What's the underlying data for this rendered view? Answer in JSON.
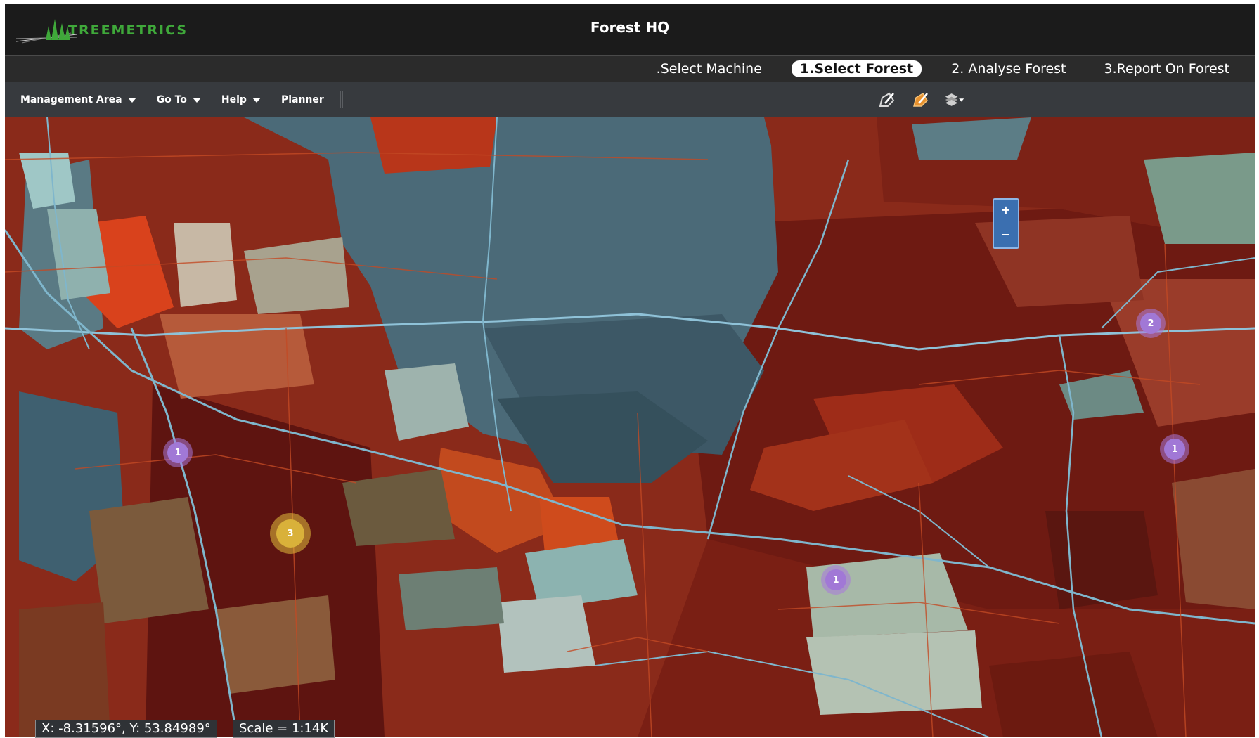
{
  "header": {
    "logo_text": "TREEMETRICS",
    "title": "Forest HQ"
  },
  "steps": [
    {
      "label": ".Select Machine",
      "active": false
    },
    {
      "label": "1.Select Forest",
      "active": true
    },
    {
      "label": "2. Analyse Forest",
      "active": false
    },
    {
      "label": "3.Report On Forest",
      "active": false
    }
  ],
  "toolbar": {
    "menus": [
      "Management Area",
      "Go To",
      "Help",
      "Planner"
    ],
    "tools": [
      "draw-polygon-icon",
      "edit-polygon-icon",
      "layers-icon"
    ]
  },
  "zoom": {
    "in": "+",
    "out": "−"
  },
  "clusters": [
    {
      "count": "1",
      "color": "purple"
    },
    {
      "count": "3",
      "color": "yellow"
    },
    {
      "count": "1",
      "color": "purple"
    },
    {
      "count": "2",
      "color": "purple"
    },
    {
      "count": "1",
      "color": "purple"
    }
  ],
  "status": {
    "coords": "X: -8.31596°, Y: 53.84989°",
    "scale": "Scale = 1:14K"
  }
}
